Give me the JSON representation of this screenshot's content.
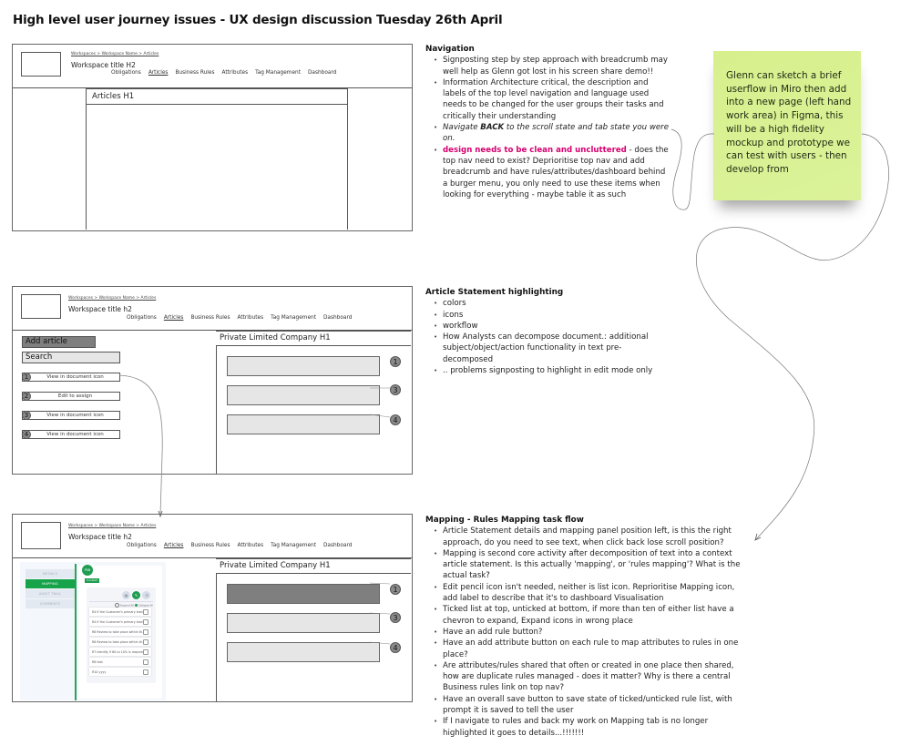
{
  "page_title": "High level user journey issues - UX design discussion Tuesday 26th April",
  "wireframe_common": {
    "breadcrumb": "Workspaces > Workspace Name > Articles",
    "nav": [
      "Obligations",
      "Articles",
      "Business Rules",
      "Attributes",
      "Tag Management",
      "Dashboard"
    ],
    "active_nav": "Articles"
  },
  "wireframe1": {
    "workspace_title": "Workspace title H2",
    "content_heading": "Articles H1"
  },
  "wireframe2": {
    "workspace_title": "Workspace title h2",
    "add_article_label": "Add article",
    "search_placeholder": "Search",
    "list_items": [
      {
        "num": "1",
        "label": "View in document icon"
      },
      {
        "num": "2",
        "label": "Edit to assign"
      },
      {
        "num": "3",
        "label": "View in document icon"
      },
      {
        "num": "4",
        "label": "View in document icon"
      }
    ],
    "panel_heading": "Private Limited Company H1",
    "statement_badges": [
      "1",
      "3",
      "4"
    ]
  },
  "wireframe3": {
    "workspace_title": "Workspace title h2",
    "panel_heading": "Private Limited Company H1",
    "statement_badges": [
      "1",
      "3",
      "4"
    ],
    "side_tabs": [
      "DETAILS",
      "MAPPING",
      "AUDIT TRAIL",
      "COMMENTS"
    ],
    "active_side_tab": "MAPPING",
    "avatar_initials": "PSB",
    "context_tag": "Context",
    "expand_all": "Expand All",
    "collapse_all": "Collapse All",
    "toolbar_icons": [
      "list-icon",
      "edit-pencil-icon",
      "mapping-icon"
    ],
    "rules": [
      "R4 If the Customer's primary trad...",
      "R4 If the Customer's primary trad...",
      "R6 Review to take place within th...",
      "R6 Review to take place within th...",
      "R7 Identify if 80 to 10% is required",
      "R8 test",
      "R10 yyyy"
    ]
  },
  "notes": {
    "navigation": {
      "heading": "Navigation",
      "items": [
        {
          "text": "Signposting step by step approach with breadcrumb may well help as Glenn got lost in his screen share demo!!"
        },
        {
          "text": "Information Architecture critical, the description and labels of the top level navigation and language used needs to be changed for the user groups their tasks and critically their understanding"
        },
        {
          "italic_prefix": "Navigate ",
          "bold": "BACK",
          "italic_suffix": " to the scroll state and tab state you were on."
        },
        {
          "highlight": "design needs to be clean and uncluttered",
          "text": " - does the top nav need to exist? Deprioritise top nav and add breadcrumb and have rules/attributes/dashboard behind a burger menu, you only need to use these items when looking for everything - maybe table it as such"
        }
      ]
    },
    "highlighting": {
      "heading": "Article Statement highlighting",
      "items": [
        "colors",
        "icons",
        "workflow",
        "How Analysts can decompose document.: additional subject/object/action functionality in text pre-decomposed",
        ".. problems signposting to highlight in edit mode only"
      ]
    },
    "mapping": {
      "heading": "Mapping - Rules Mapping task flow",
      "items": [
        "Article Statement details and mapping panel position left, is this the right approach, do you need to see text, when click back lose scroll position?",
        "Mapping is second core activity after decomposition of text into a context article statement. Is this actually 'mapping', or 'rules mapping'? What is the actual task?",
        "Edit pencil icon isn't needed, neither is list icon. Reprioritise Mapping icon, add label to describe that it's to dashboard Visualisation",
        "Ticked list at top, unticked at bottom, if more than ten of either list have a chevron to expand, Expand icons in wrong place",
        "Have an add rule button?",
        "Have an add attribute button on each rule to map attributes to rules in one place?",
        "Are attributes/rules shared that often or created in one place then shared, how are duplicate rules managed - does it matter? Why is there a central Business rules link on top nav?",
        "Have an overall save button to save state of ticked/unticked rule list, with prompt it is saved to tell the user",
        "If I navigate to rules and back my work on Mapping tab is no longer highlighted it goes to details...!!!!!!!"
      ]
    }
  },
  "sticky_note": {
    "text": "Glenn can sketch a brief userflow in Miro then add into a new page (left hand work area) in Figma, this will be a high fidelity mockup and prototype we can test with users - then develop from",
    "color": "#d8f090"
  },
  "colors": {
    "highlight_pink": "#d6006f",
    "mapping_green": "#17a34a",
    "wire_grey": "#7f7f7f",
    "wire_light": "#e6e6e6"
  }
}
